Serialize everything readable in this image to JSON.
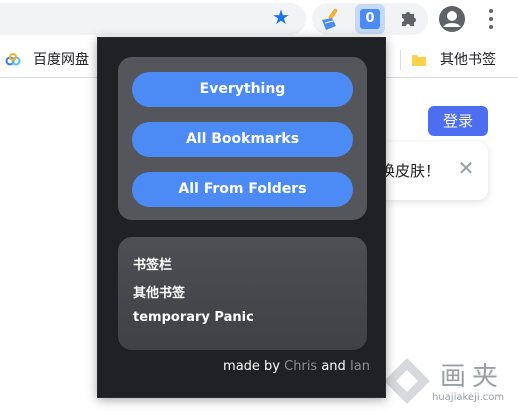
{
  "toolbar": {
    "star_icon": "bookmark-star-icon",
    "extensions": [
      "broom-extension-icon",
      "bookmark-extension-icon",
      "puzzle-extensions-icon"
    ],
    "active_extension_glyph": "0",
    "avatar_icon": "account-avatar-icon",
    "menu_icon": "kebab-menu-icon",
    "accent_color": "#1a73e8"
  },
  "bookmark_bar": {
    "left_item": "百度网盘",
    "right_item": "其他书签"
  },
  "page": {
    "login_label": "登录",
    "notice_text": "换皮肤！",
    "login_color": "#4e6ef2"
  },
  "popup": {
    "buttons": [
      "Everything",
      "All Bookmarks",
      "All From Folders"
    ],
    "folders": [
      "书签栏",
      "其他书签",
      "temporary Panic"
    ],
    "credits": {
      "prefix": "made by",
      "author1": "Chris",
      "joiner": "and",
      "author2": "Ian"
    },
    "button_color": "#4c8bf5",
    "background_color": "#202124"
  },
  "watermark": {
    "title": "画夹",
    "url": "huajiakeji.com"
  }
}
